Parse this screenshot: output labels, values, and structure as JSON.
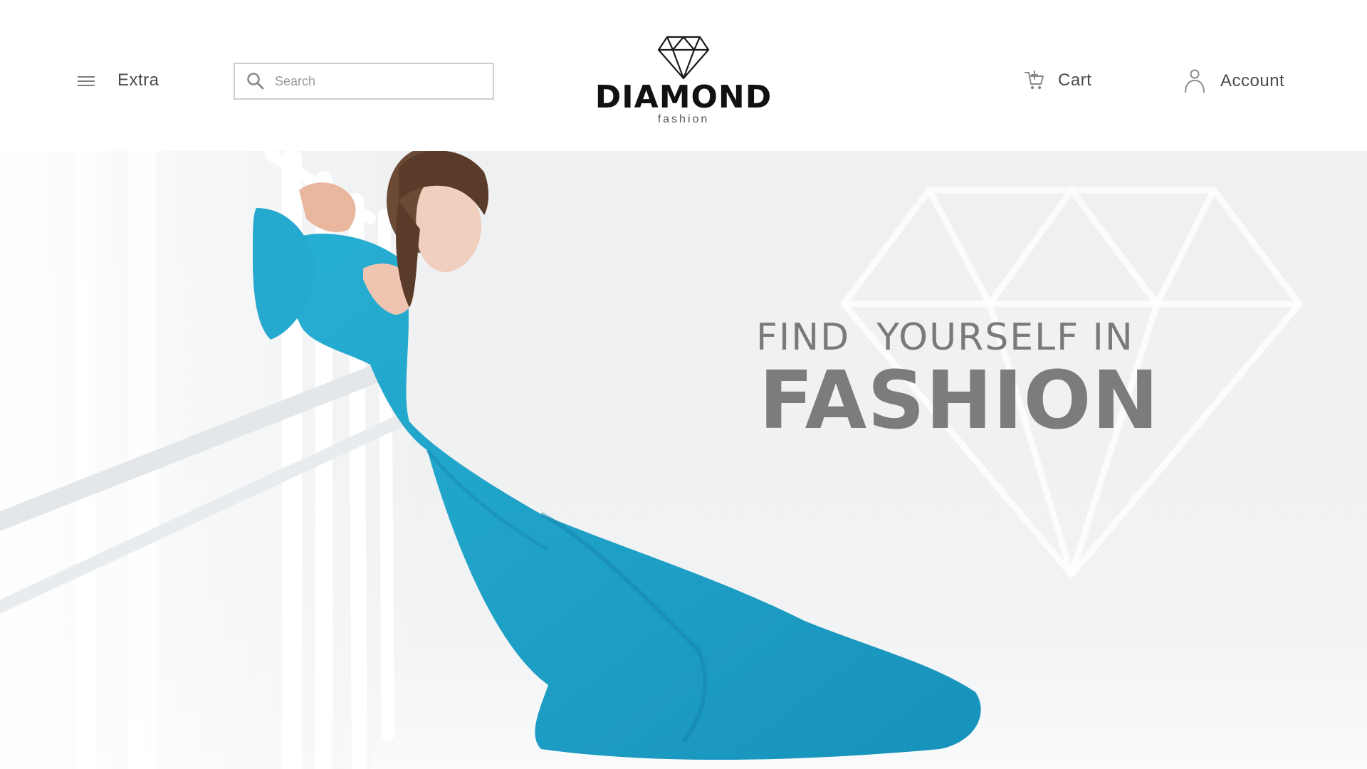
{
  "header": {
    "menu_label": "Extra",
    "search": {
      "placeholder": "Search",
      "value": ""
    },
    "logo": {
      "name": "DIAMOND",
      "subtitle": "fashion"
    },
    "cart_label": "Cart",
    "account_label": "Account"
  },
  "hero": {
    "headline_line1": "FIND  YOURSELF IN",
    "headline_line2": "FASHION",
    "dress_color": "#1fa3c9",
    "text_color": "#7a7a7a"
  },
  "icons": {
    "menu": "hamburger-icon",
    "search": "search-icon",
    "logo": "diamond-icon",
    "cart": "cart-icon",
    "account": "user-icon"
  }
}
